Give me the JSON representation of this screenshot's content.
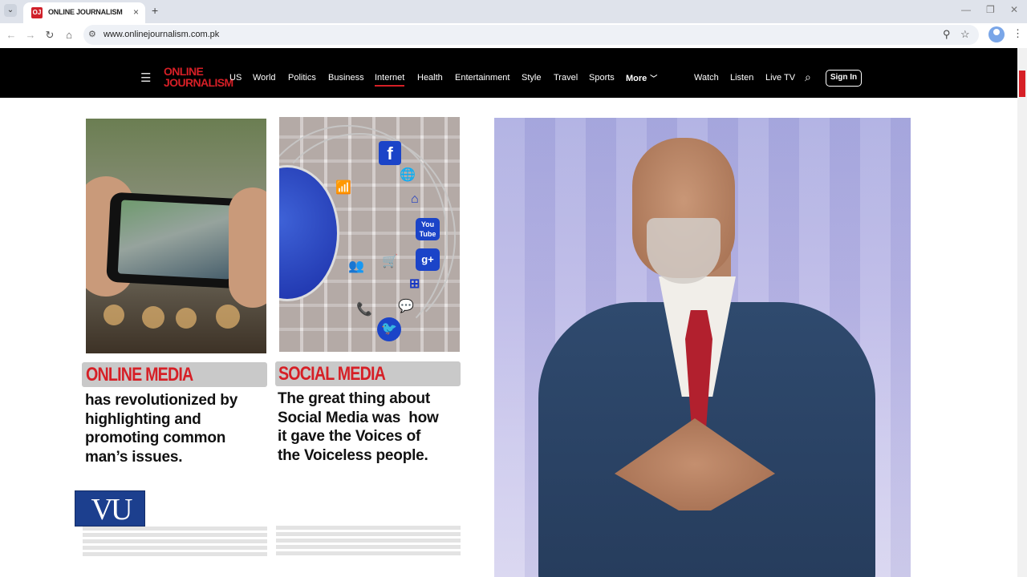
{
  "browser": {
    "tab_title": "ONLINE JOURNALISM",
    "favicon_text": "OJ",
    "url": "www.onlinejournalism.com.pk"
  },
  "site": {
    "logo_line1": "ONLINE",
    "logo_line2": "JOURNALISM",
    "nav": [
      "US",
      "World",
      "Politics",
      "Business",
      "Internet",
      "Health",
      "Entertainment",
      "Style",
      "Travel",
      "Sports"
    ],
    "active_nav": "Internet",
    "more_label": "More",
    "right_nav": [
      "Watch",
      "Listen",
      "Live TV"
    ],
    "signin_label": "Sign In",
    "accent_color": "#d61f26"
  },
  "cards": [
    {
      "title": "ONLINE MEDIA",
      "lines": [
        "has revolutionized by",
        "highlighting and",
        "promoting common",
        "man’s issues."
      ]
    },
    {
      "title": "SOCIAL MEDIA",
      "lines": [
        "The great thing about",
        "Social Media was  how",
        "it gave the Voices of",
        "the Voiceless people."
      ]
    }
  ],
  "social_icons": {
    "facebook": "f",
    "youtube_line1": "You",
    "youtube_line2": "Tube",
    "googleplus": "g+",
    "twitter": "🐦"
  },
  "vu_logo": "VU"
}
